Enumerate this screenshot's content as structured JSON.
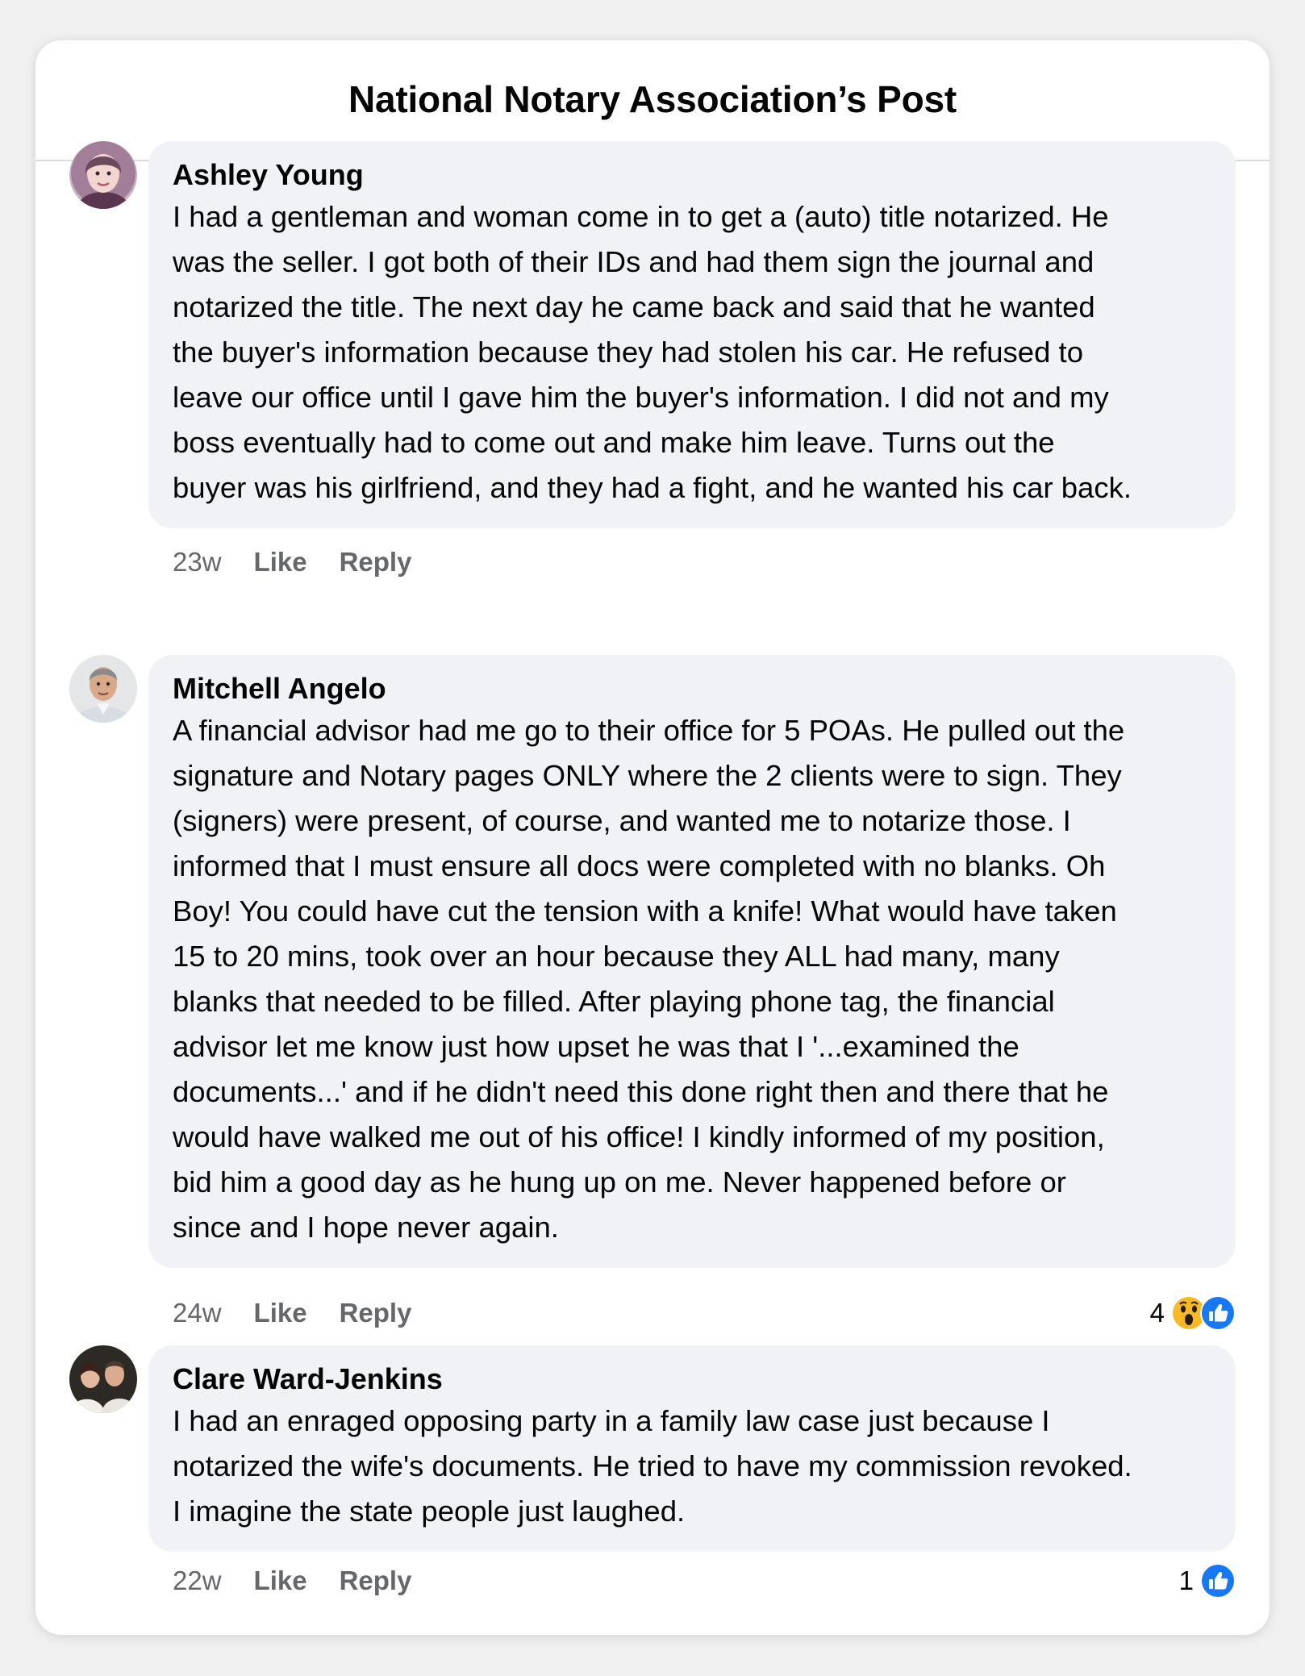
{
  "header": {
    "title": "National Notary Association’s Post"
  },
  "comments": [
    {
      "author": "Ashley Young",
      "text": "I had a gentleman and woman come in to get a (auto) title notarized. He\nwas the seller. I got both of their IDs and had them sign the journal and\nnotarized the title. The next day he came back and said that he wanted\nthe buyer's information because they had stolen his car. He refused to\nleave our office until I gave him the buyer's information. I did not and my\nboss eventually had to come out and make him leave. Turns out the\nbuyer was his girlfriend, and they had a fight, and he wanted his car back.",
      "time": "23w",
      "like_label": "Like",
      "reply_label": "Reply"
    },
    {
      "author": "Mitchell Angelo",
      "text": "A financial advisor had me go to their office for 5 POAs. He pulled out the\nsignature and Notary pages ONLY where the 2 clients were to sign. They\n(signers) were present, of course, and wanted me to notarize those. I\ninformed that I must ensure all docs were completed with no blanks. Oh\nBoy! You could have cut the tension with a knife! What would have taken\n15 to 20 mins, took over an hour because they ALL had many, many\nblanks that needed to be filled. After playing phone tag, the financial\nadvisor let me know just how upset he was that I '...examined the\ndocuments...' and if he didn't need this done right then and there that he\nwould have walked me out of his office! I kindly informed of my position,\nbid him a good day as he hung up on me. Never happened before or\nsince and I hope never again.",
      "time": "24w",
      "like_label": "Like",
      "reply_label": "Reply",
      "reaction_count": "4",
      "reactions": [
        "wow-emoji-icon",
        "like-thumb-icon"
      ]
    },
    {
      "author": "Clare Ward-Jenkins",
      "text": "I had an enraged opposing party in a family law case just because I\nnotarized the wife's documents. He tried to have my commission revoked.\nI imagine the state people just laughed.",
      "time": "22w",
      "like_label": "Like",
      "reply_label": "Reply",
      "reaction_count": "1",
      "reactions": [
        "like-thumb-icon"
      ]
    }
  ],
  "colors": {
    "bubble_bg": "#f0f2f5",
    "meta_text": "#65676b",
    "like_blue": "#1877f2",
    "wow_yellow": "#f7b928"
  }
}
